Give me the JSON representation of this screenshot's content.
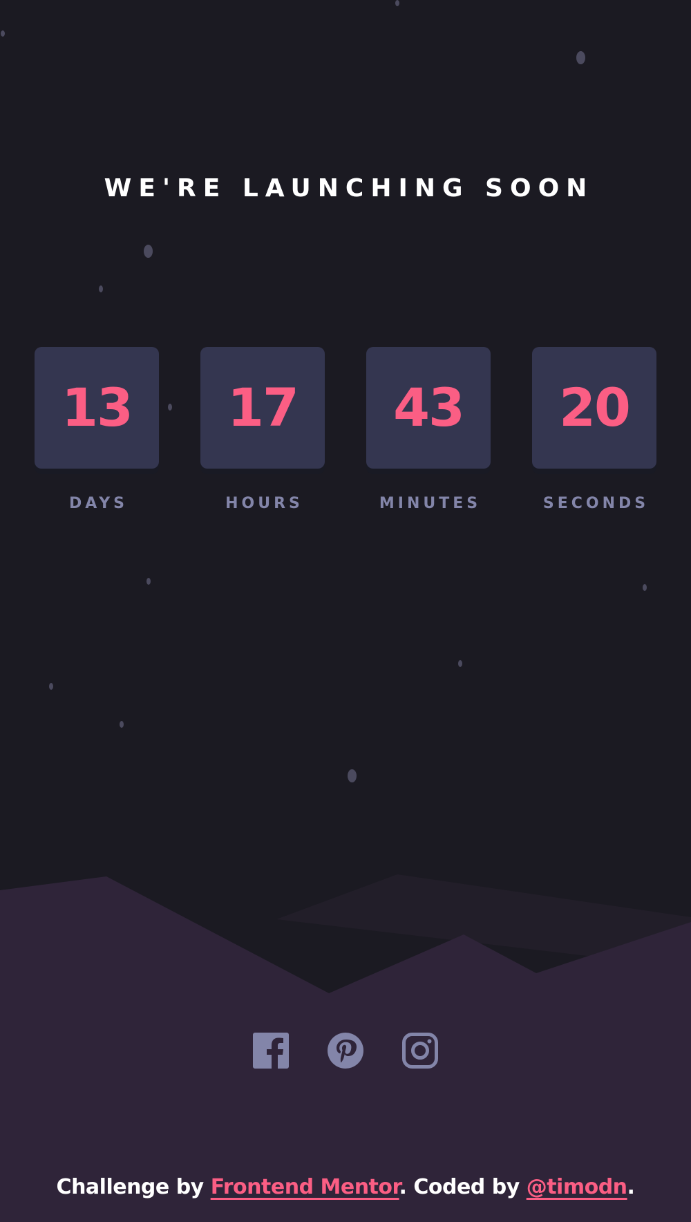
{
  "header": {
    "title": "WE'RE LAUNCHING SOON"
  },
  "countdown": {
    "units": [
      {
        "value": "13",
        "label": "DAYS"
      },
      {
        "value": "17",
        "label": "HOURS"
      },
      {
        "value": "43",
        "label": "MINUTES"
      },
      {
        "value": "20",
        "label": "SECONDS"
      }
    ]
  },
  "social": {
    "icons": [
      "facebook-icon",
      "pinterest-icon",
      "instagram-icon"
    ]
  },
  "footer": {
    "prefix": "Challenge by ",
    "link1": "Frontend Mentor",
    "middle": ". Coded by ",
    "link2": "@timodn",
    "suffix": "."
  },
  "colors": {
    "background": "#1b1a22",
    "card": "#343650",
    "accent": "#fb5e84",
    "label": "#8385a9",
    "hills": "#2f2439"
  }
}
